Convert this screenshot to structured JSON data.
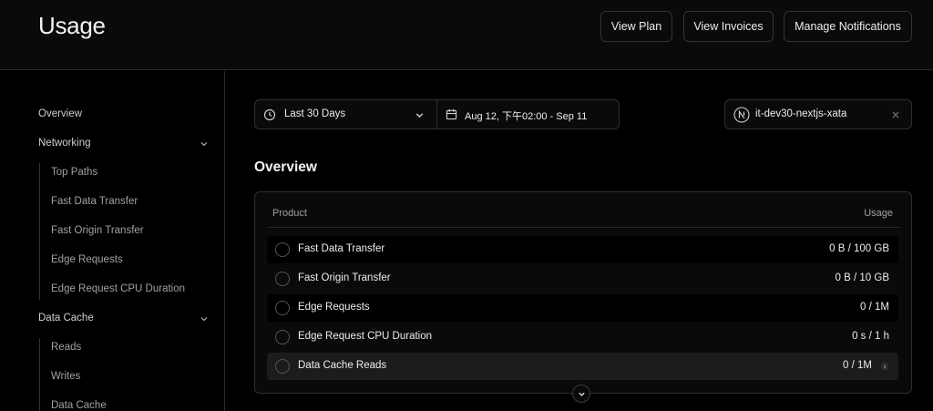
{
  "header": {
    "title": "Usage",
    "buttons": [
      "View Plan",
      "View Invoices",
      "Manage Notifications"
    ]
  },
  "sidebar": {
    "items": [
      {
        "label": "Overview"
      },
      {
        "label": "Networking",
        "expandable": true
      },
      {
        "label": "Top Paths"
      },
      {
        "label": "Fast Data Transfer"
      },
      {
        "label": "Fast Origin Transfer"
      },
      {
        "label": "Edge Requests"
      },
      {
        "label": "Edge Request CPU Duration"
      },
      {
        "label": "Data Cache",
        "expandable": true
      },
      {
        "label": "Reads"
      },
      {
        "label": "Writes"
      },
      {
        "label": "Data Cache"
      }
    ]
  },
  "filters": {
    "range": "Last 30 Days",
    "dates": "Aug 12, 下午02:00 - Sep 11",
    "project": "it-dev30-nextjs-xata"
  },
  "overview": {
    "title": "Overview",
    "columns": [
      "Product",
      "Usage"
    ],
    "rows": [
      {
        "product": "Fast Data Transfer",
        "usage": "0 B / 100 GB"
      },
      {
        "product": "Fast Origin Transfer",
        "usage": "0 B / 10 GB"
      },
      {
        "product": "Edge Requests",
        "usage": "0 / 1M"
      },
      {
        "product": "Edge Request CPU Duration",
        "usage": "0 s / 1 h"
      },
      {
        "product": "Data Cache Reads",
        "usage": "0 / 1M"
      }
    ]
  },
  "colors": {
    "background": "#000000",
    "panel": "#0a0a0a",
    "border": "#2e2e2e",
    "highlight": "#1c1c1c"
  }
}
